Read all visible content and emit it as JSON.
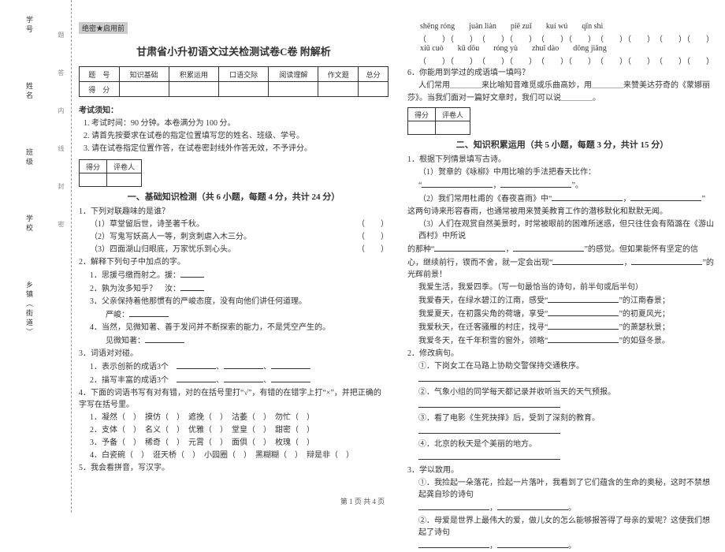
{
  "gutter": {
    "labels": [
      "学号",
      "姓名",
      "班级",
      "学校",
      "乡镇（街道）"
    ],
    "hint": "题答内线封密"
  },
  "secret": "绝密★启用前",
  "title": "甘肃省小升初语文过关检测试卷C卷 附解析",
  "scoreTable": {
    "h1": "题　号",
    "c1": "知识基础",
    "c2": "积累运用",
    "c3": "口语交际",
    "c4": "阅读理解",
    "c5": "作文题",
    "c6": "总分",
    "h2": "得　分"
  },
  "notice": {
    "head": "考试须知：",
    "items": [
      "考试时间：90 分钟。本卷满分为 100 分。",
      "请首先按要求在试卷的指定位置填写您的姓名、班级、学号。",
      "请在试卷指定位置作答，在试卷密封线外作答无效，不予评分。"
    ]
  },
  "miniScore": {
    "a": "得分",
    "b": "评卷人"
  },
  "part1": {
    "title": "一、基础知识检测（共 6 小题，每题 4 分，共计 24 分）",
    "q1": {
      "stem": "1．下列对联趣味的是谁？",
      "lines": [
        "（1）草堂留后世，诗圣著千秋。",
        "（2）写鬼写妖高人一等，刺贪刺虐入木三分。",
        "（3）四面湖山归眼底，万家忧乐到心头。"
      ]
    },
    "q2": {
      "stem": "2．解释下列句子中加点的字。",
      "lines": [
        "1．思援弓缴而射之。援：",
        "2．孰为汝多知乎？　汝：",
        "3．父亲保持着他那惯有的严峻态度，没有向他们讲任何道理。",
        "　　严峻：",
        "4．当然，见微知著、善于发问并不断探索的能力，不是凭空产生的。",
        "　　见微知著："
      ]
    },
    "q3": {
      "stem": "3．词语对对碰。",
      "lines": [
        "1．表示创新的成语3个",
        "2．描写丰富的成语3个"
      ]
    },
    "q4": {
      "stem": "4．下面的词语书写有对有错，对的在括号里打“√”，有错的在错字上打“×”，并把正确的字写在括号里。",
      "rows": [
        "1．凝然（　）　摸仿（　）　遮挽（　）　沽萎（　）　勿忙（　）",
        "2．支体（　）　名义（　）　优雅（　）　堂皇（　）　甜密（　）",
        "3．予备（　）　稀奇（　）　元霄（　）　面俱（　）　枚瑰（　）",
        "4．白瓷碗（　）　诳天桥（　）　小园圈（　）　黑糊糊（　）　辩是非（　）"
      ]
    },
    "q5": "5．我会看拼音，写汉字。"
  },
  "colR": {
    "pinyin1": [
      "shēng róng",
      "juàn liàn",
      "piē zuǐ",
      "kuí wú",
      "qīn shì"
    ],
    "pinyin2": [
      "xiū cuò",
      "kū dōu",
      "róng yù",
      "zhuī dào",
      "dōng jiāng"
    ],
    "q6": {
      "stem": "6．你能用到学过的成语填一填吗？",
      "line1": "人们常用＿＿＿＿来比喻知音难觅或乐曲高妙，用＿＿＿＿来赞美达芬奇的《蒙娜丽",
      "line2": "莎》。当我们面对一篇好文章时，我们可以说＿＿＿＿。"
    },
    "part2": {
      "title": "二、知识积累运用（共 5 小题，每题 3 分，共计 15 分）",
      "q1": {
        "stem": "1．根据下列情景填写古诗。",
        "a": "（1）贺章的《咏柳》中用比喻的手法把春天比作：",
        "b": "（2）我们常用杜甫的《春夜喜雨》中“",
        "b2": "这两句诗来形容春雨，也通常被用来赞美教育工作的潜移默化和默默无闻。",
        "c": "（3）人们在观赏自然美景时，时常被眼前的困难所迷惑，但只往住会有陌潞在《游山西村》中所说",
        "c2": "的那种“",
        "c2b": "”的感觉。但如果能怀有坚定的信",
        "c3": "心，继续前行，锲而不舍，就一定会出现“",
        "c3b": "”的光辉前景！"
      },
      "q_season": {
        "stem": "我爱生活，我爱四季。（写一句最恰当的诗句，前半句或后半句）",
        "lines": [
          "我爱春天，在绿水碧江的江南，感受“",
          "我爱夏天，在初露尖角的荷塘，享受“",
          "我爱秋天，在迁客骚雁的村庄，找寻“",
          "我爱冬天，在千年积雪的窗外，领略“"
        ],
        "tails": [
          "”的江南春景；",
          "”的初夏风光；",
          "”的萧瑟秋景；",
          "”的如昼冬景。"
        ]
      },
      "q2": {
        "stem": "2．修改病句。",
        "items": [
          "下岗女工在马路上协助交警保持交通秩序。",
          "气象小组的同学每天都记录并收听当天的天气预报。",
          "看了电影《生死抉择》后，受到了深刻的教育。",
          "北京的秋天是个美丽的地方。"
        ]
      },
      "q3": {
        "stem": "3．学以致用。",
        "a": "①．我捡起一朵落花，捡起一片落叶，我看到了它们蕴含的生命的奥秘，这时不禁想起龚自珍的诗句",
        "b": "②．母爱是世界上最伟大的爱，做儿女的怎么能够报答得了母亲的爱呢？这使我们想起了诗句"
      }
    }
  },
  "pageNum": "第 1 页 共 4 页"
}
